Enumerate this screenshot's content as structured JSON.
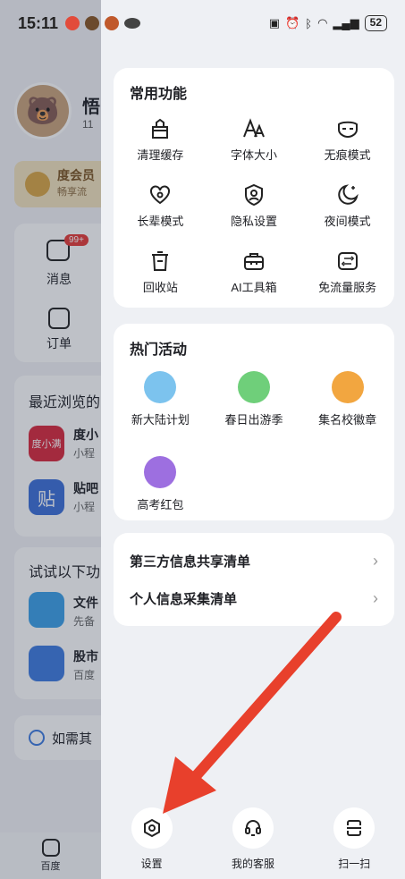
{
  "status": {
    "time": "15:11",
    "battery": "52"
  },
  "background": {
    "profile_name": "悟",
    "profile_sub": "11",
    "vip_title": "度会员",
    "vip_sub": "畅享流",
    "msg_label": "消息",
    "msg_badge": "99+",
    "order_label": "订单",
    "recent_title": "最近浏览的",
    "recent_items": [
      {
        "name": "度小",
        "sub": "小程",
        "icon_text": "度小满"
      },
      {
        "name": "贴吧",
        "sub": "小程",
        "icon_text": "贴"
      }
    ],
    "try_title": "试试以下功",
    "try_items": [
      {
        "name": "文件",
        "sub": "先备"
      },
      {
        "name": "股市",
        "sub": "百度"
      }
    ],
    "ai_text": "如需其",
    "tab_home": "百度"
  },
  "common": {
    "title": "常用功能",
    "items": [
      {
        "label": "清理缓存",
        "icon": "broom-icon"
      },
      {
        "label": "字体大小",
        "icon": "font-size-icon"
      },
      {
        "label": "无痕模式",
        "icon": "mask-icon"
      },
      {
        "label": "长辈模式",
        "icon": "heart-icon"
      },
      {
        "label": "隐私设置",
        "icon": "shield-user-icon"
      },
      {
        "label": "夜间模式",
        "icon": "moon-icon"
      },
      {
        "label": "回收站",
        "icon": "trash-icon"
      },
      {
        "label": "AI工具箱",
        "icon": "toolbox-icon"
      },
      {
        "label": "免流量服务",
        "icon": "data-card-icon"
      }
    ]
  },
  "hot": {
    "title": "热门活动",
    "items": [
      {
        "label": "新大陆计划",
        "color": "#7cc3ee"
      },
      {
        "label": "春日出游季",
        "color": "#6fcf7a"
      },
      {
        "label": "集名校徽章",
        "color": "#f2a640"
      },
      {
        "label": "高考红包",
        "color": "#9d6fe0"
      }
    ]
  },
  "links": [
    {
      "label": "第三方信息共享清单"
    },
    {
      "label": "个人信息采集清单"
    }
  ],
  "bottom": [
    {
      "label": "设置",
      "icon": "settings-icon"
    },
    {
      "label": "我的客服",
      "icon": "headset-icon"
    },
    {
      "label": "扫一扫",
      "icon": "scan-icon"
    }
  ],
  "accent": "#e8402c"
}
